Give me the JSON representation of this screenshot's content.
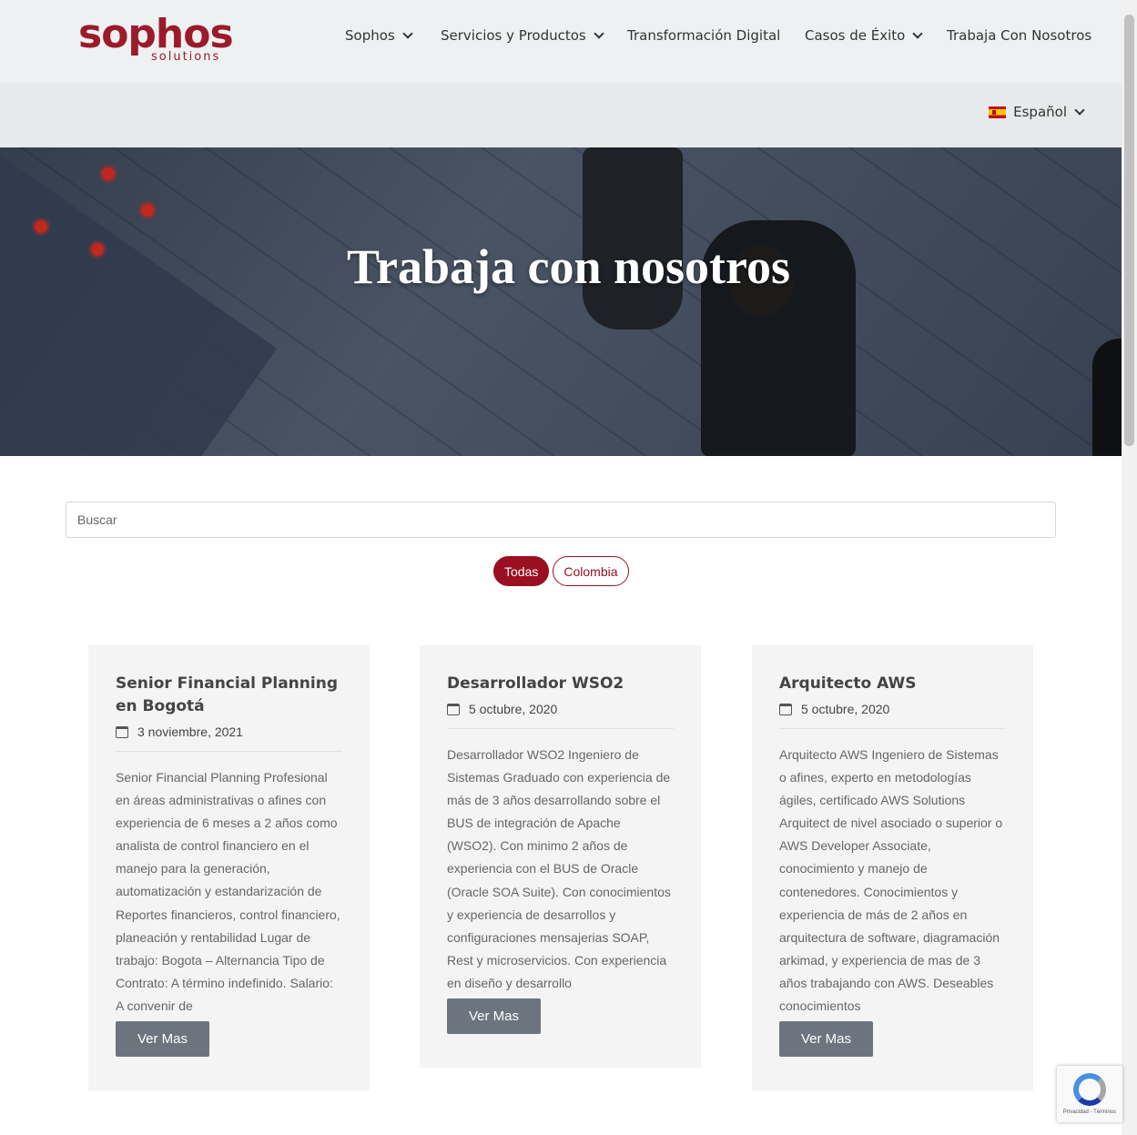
{
  "header": {
    "logo_main": "sophos",
    "logo_sub": "solutions",
    "nav": [
      {
        "label": "Sophos",
        "dropdown": true
      },
      {
        "label": "Servicios y Productos",
        "dropdown": true
      },
      {
        "label": "Transformación Digital",
        "dropdown": false
      },
      {
        "label": "Casos de Éxito",
        "dropdown": true
      },
      {
        "label": "Trabaja Con Nosotros",
        "dropdown": false
      }
    ],
    "language": "Español"
  },
  "hero": {
    "title": "Trabaja con nosotros"
  },
  "search": {
    "placeholder": "Buscar",
    "value": ""
  },
  "filters": [
    {
      "label": "Todas",
      "active": true
    },
    {
      "label": "Colombia",
      "active": false
    }
  ],
  "jobs": [
    {
      "title": "Senior Financial Planning en Bogotá",
      "date": "3 noviembre, 2021",
      "excerpt": "Senior Financial Planning Profesional en áreas administrativas o afines con experiencia de 6 meses a 2 años como analista de control financiero en el manejo para la generación, automatización y estandarización de Reportes financieros, control financiero, planeación y rentabilidad Lugar de trabajo: Bogota – Alternancia Tipo de Contrato: A término indefinido. Salario: A convenir de",
      "button": "Ver Mas"
    },
    {
      "title": "Desarrollador WSO2",
      "date": "5 octubre, 2020",
      "excerpt": "Desarrollador WSO2 Ingeniero de Sistemas Graduado con experiencia de más de 3 años desarrollando sobre el BUS de integración de Apache (WSO2). Con minimo 2 años de experiencia con el BUS de Oracle (Oracle SOA Suite). Con conocimientos y experiencia de desarrollos y configuraciones mensajerias SOAP, Rest y microservicios. Con experiencia en diseño y desarrollo",
      "button": "Ver Mas"
    },
    {
      "title": "Arquitecto AWS",
      "date": "5 octubre, 2020",
      "excerpt": "Arquitecto AWS Ingeniero de Sistemas o afines, experto en metodologías ágiles, certificado AWS Solutions Arquitect de nivel asociado o superior o AWS Developer Associate, conocimiento y manejo de contenedores. Conocimientos y experiencia de más de 2 años en arquitectura de software, diagramación arkimad, y experiencia de mas de 3 años trabajando con AWS. Deseables conocimientos",
      "button": "Ver Mas"
    }
  ],
  "recaptcha": {
    "text": "Privacidad - Términos"
  },
  "colors": {
    "brand": "#9b0f22",
    "button": "#6c757d",
    "card_bg": "#f4f4f4"
  }
}
